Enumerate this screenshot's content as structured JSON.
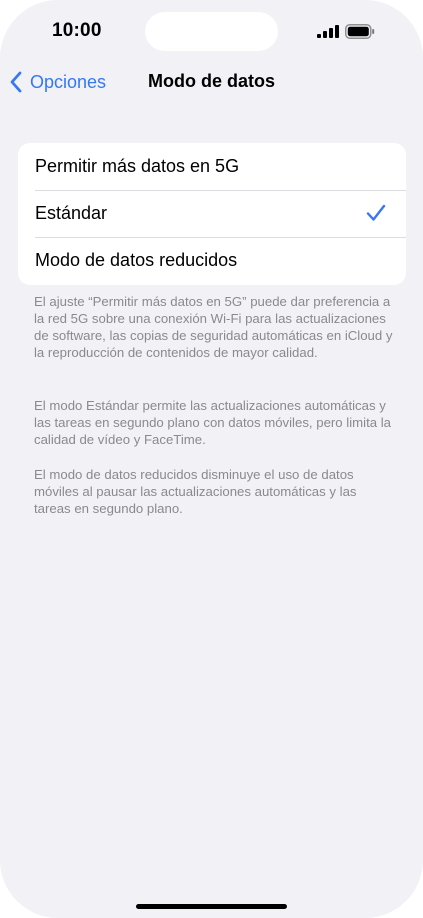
{
  "status_bar": {
    "time": "10:00"
  },
  "nav": {
    "back_label": "Opciones",
    "title": "Modo de datos"
  },
  "options": [
    {
      "label": "Permitir más datos en 5G",
      "selected": false
    },
    {
      "label": "Estándar",
      "selected": true
    },
    {
      "label": "Modo de datos reducidos",
      "selected": false
    }
  ],
  "footnotes": [
    "El ajuste “Permitir más datos en 5G” puede dar preferencia a la red 5G sobre una conexión Wi-Fi para las actualizaciones de software, las copias de seguridad automáticas en iCloud y la reproducción de contenidos de mayor calidad.",
    "El modo Estándar permite las actualizaciones automáticas y las tareas en segundo plano con datos móviles, pero limita la calidad de vídeo y FaceTime.",
    "El modo de datos reducidos disminuye el uso de datos móviles al pausar las actualizaciones automáticas y las tareas en segundo plano."
  ],
  "colors": {
    "accent": "#3478f6",
    "background": "#f1f1f6",
    "footnote_text": "#8a8a8e"
  },
  "icons": {
    "back": "chevron-left-icon",
    "selected": "checkmark-icon",
    "signal": "cellular-signal-icon",
    "battery": "battery-icon"
  }
}
